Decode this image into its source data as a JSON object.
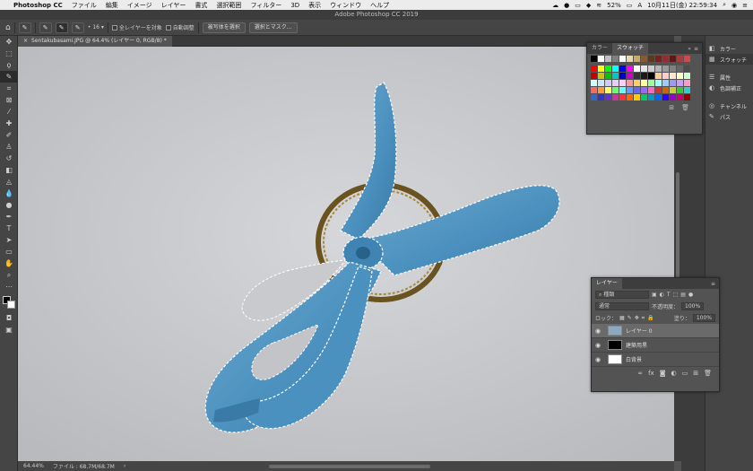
{
  "menubar": {
    "apple": "",
    "app": "Photoshop CC",
    "items": [
      "ファイル",
      "編集",
      "イメージ",
      "レイヤー",
      "書式",
      "選択範囲",
      "フィルター",
      "3D",
      "表示",
      "ウィンドウ",
      "ヘルプ"
    ],
    "battery": "52%",
    "datetime": "10月11日(金)  22:59:34"
  },
  "window": {
    "title": "Adobe Photoshop CC 2019"
  },
  "options": {
    "size_value": "16",
    "sample_all_layers": "全レイヤーを対象",
    "auto_enhance": "自動調整",
    "select_subject": "被写体を選択",
    "select_mask": "選択とマスク..."
  },
  "document": {
    "tab_close": "×",
    "tab_title": "Sentakubasami.JPG @ 64.4% (レイヤー 0, RGB/8) *"
  },
  "status": {
    "zoom": "64.44%",
    "file_info": "ファイル : 68.7M/68.7M",
    "arrow": "›"
  },
  "right_dock": {
    "items": [
      {
        "icon": "color-icon",
        "label": "カラー"
      },
      {
        "icon": "swatches-icon",
        "label": "スウォッチ"
      },
      {
        "icon": "properties-icon",
        "label": "属性"
      },
      {
        "icon": "adjustments-icon",
        "label": "色調補正"
      },
      {
        "icon": "channels-icon",
        "label": "チャンネル"
      },
      {
        "icon": "paths-icon",
        "label": "パス"
      }
    ]
  },
  "swatches_panel": {
    "tab_color": "カラー",
    "tab_swatches": "スウォッチ"
  },
  "swatch_colors": {
    "row1": [
      "#000000",
      "#ffffff",
      "#c0c0c0",
      "#808080",
      "#ffffff",
      "#e8d7b0",
      "#c8a96a",
      "#8b5a2b",
      "#5a3a1a",
      "#7a1e1e",
      "#9b2a2a",
      "#6b1414",
      "#b03a3a",
      "#d04848"
    ],
    "grid": [
      "#ff0000",
      "#ffff00",
      "#00ff00",
      "#00ffff",
      "#0000ff",
      "#ff00ff",
      "#ffffff",
      "#e6e6e6",
      "#cccccc",
      "#b3b3b3",
      "#999999",
      "#808080",
      "#666666",
      "#4d4d4d",
      "#c80000",
      "#c8c800",
      "#00c800",
      "#00c8c8",
      "#0000c8",
      "#c800c8",
      "#333333",
      "#1a1a1a",
      "#000000",
      "#ffcc99",
      "#ffcccc",
      "#ffe6cc",
      "#ffffcc",
      "#ccffcc",
      "#ccffff",
      "#cce6ff",
      "#ccccff",
      "#e6ccff",
      "#ffccff",
      "#ff9999",
      "#ffcc66",
      "#ffff99",
      "#99ff99",
      "#99ffff",
      "#99ccff",
      "#9999ff",
      "#cc99ff",
      "#ff99cc",
      "#ff6666",
      "#ff9933",
      "#ffff66",
      "#66ff66",
      "#66ffff",
      "#6699ff",
      "#6666ff",
      "#9966ff",
      "#ff66cc",
      "#cc3333",
      "#cc6600",
      "#cccc33",
      "#33cc33",
      "#33cccc",
      "#3366cc",
      "#3333cc",
      "#6633cc",
      "#cc3399",
      "#ff3333",
      "#ff6600",
      "#ffcc00",
      "#00cc66",
      "#0099cc",
      "#0066ff",
      "#3300ff",
      "#9900cc",
      "#cc0066",
      "#990000"
    ]
  },
  "layers_panel": {
    "tab": "レイヤー",
    "filter": "種類",
    "blend_mode": "通常",
    "opacity_label": "不透明度：",
    "opacity_value": "100%",
    "lock_label": "ロック：",
    "fill_label": "塗り：",
    "fill_value": "100%",
    "layers": [
      {
        "name": "レイヤー 0",
        "selected": true
      },
      {
        "name": "建築用黒",
        "selected": false
      },
      {
        "name": "白背景",
        "selected": false
      }
    ],
    "footer_icons": [
      "link-icon",
      "fx-icon",
      "mask-icon",
      "adjustment-icon",
      "folder-icon",
      "new-layer-icon",
      "trash-icon"
    ],
    "footer_glyphs": [
      "∞",
      "fx",
      "◙",
      "◐",
      "▭",
      "⊞",
      "🗑"
    ]
  }
}
